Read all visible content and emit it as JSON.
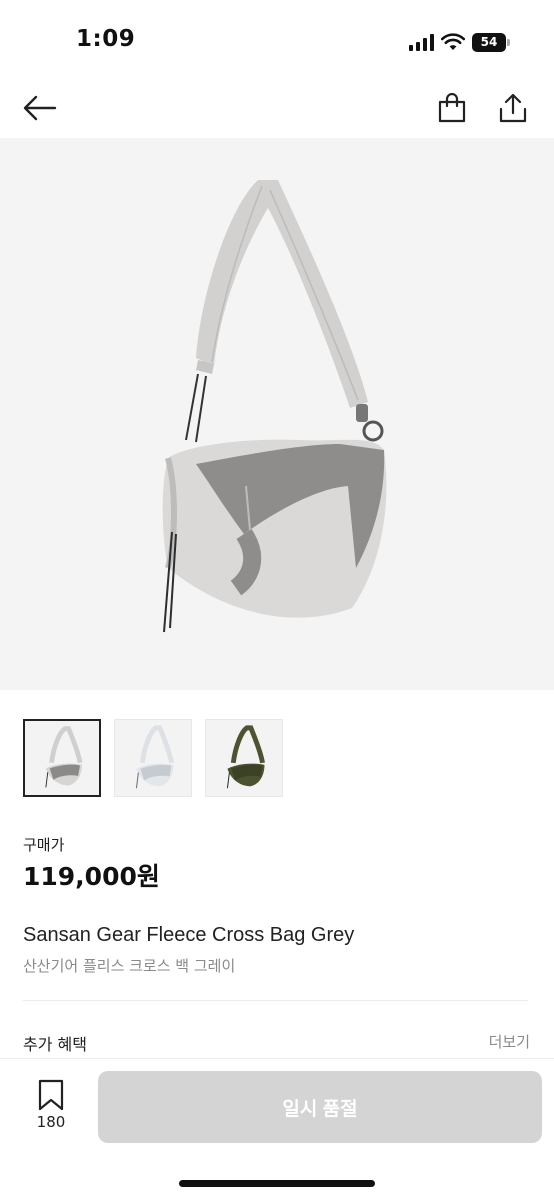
{
  "status_bar": {
    "time": "1:09",
    "battery": "54"
  },
  "nav": {
    "icons": [
      "back-arrow-icon",
      "shopping-bag-icon",
      "share-icon"
    ]
  },
  "product": {
    "price_label": "구매가",
    "price": "119,000원",
    "name_en": "Sansan Gear Fleece Cross Bag Grey",
    "name_ko": "산산기어 플리스 크로스 백 그레이",
    "thumbnails": [
      {
        "color": "grey",
        "selected": true
      },
      {
        "color": "light-grey",
        "selected": false
      },
      {
        "color": "olive",
        "selected": false
      }
    ]
  },
  "benefits": {
    "label": "추가 혜택",
    "more": "더보기"
  },
  "bottom_bar": {
    "wishlist_count": "180",
    "soldout_label": "일시 품절"
  },
  "colors": {
    "soldout_button": "#d4d4d4",
    "hero_background": "#f4f4f4"
  }
}
